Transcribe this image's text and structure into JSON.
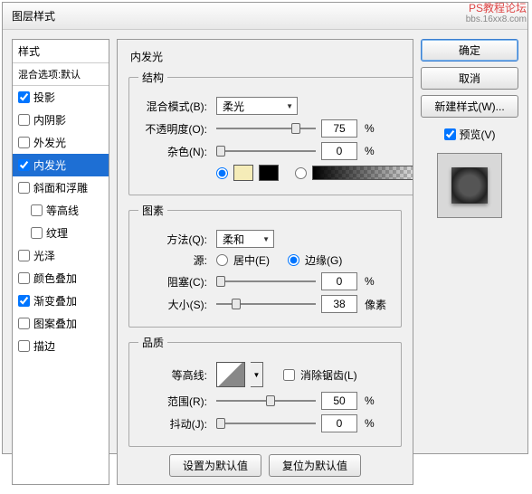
{
  "watermark": {
    "line1": "PS教程论坛",
    "line2": "bbs.16xx8.com"
  },
  "title": "图层样式",
  "styles_panel": {
    "header": "样式",
    "blend_defaults": "混合选项:默认",
    "items": [
      {
        "label": "投影",
        "checked": true,
        "indent": false
      },
      {
        "label": "内阴影",
        "checked": false,
        "indent": false
      },
      {
        "label": "外发光",
        "checked": false,
        "indent": false
      },
      {
        "label": "内发光",
        "checked": true,
        "indent": false,
        "selected": true
      },
      {
        "label": "斜面和浮雕",
        "checked": false,
        "indent": false
      },
      {
        "label": "等高线",
        "checked": false,
        "indent": true
      },
      {
        "label": "纹理",
        "checked": false,
        "indent": true
      },
      {
        "label": "光泽",
        "checked": false,
        "indent": false
      },
      {
        "label": "颜色叠加",
        "checked": false,
        "indent": false
      },
      {
        "label": "渐变叠加",
        "checked": true,
        "indent": false
      },
      {
        "label": "图案叠加",
        "checked": false,
        "indent": false
      },
      {
        "label": "描边",
        "checked": false,
        "indent": false
      }
    ]
  },
  "main": {
    "title": "内发光",
    "structure": {
      "legend": "结构",
      "blend_label": "混合模式(B):",
      "blend_value": "柔光",
      "opacity_label": "不透明度(O):",
      "opacity_value": "75",
      "opacity_unit": "%",
      "noise_label": "杂色(N):",
      "noise_value": "0",
      "noise_unit": "%"
    },
    "elements": {
      "legend": "图素",
      "technique_label": "方法(Q):",
      "technique_value": "柔和",
      "source_label": "源:",
      "source_center": "居中(E)",
      "source_edge": "边缘(G)",
      "choke_label": "阻塞(C):",
      "choke_value": "0",
      "choke_unit": "%",
      "size_label": "大小(S):",
      "size_value": "38",
      "size_unit": "像素"
    },
    "quality": {
      "legend": "品质",
      "contour_label": "等高线:",
      "antialias": "消除锯齿(L)",
      "range_label": "范围(R):",
      "range_value": "50",
      "range_unit": "%",
      "jitter_label": "抖动(J):",
      "jitter_value": "0",
      "jitter_unit": "%"
    },
    "buttons": {
      "set_default": "设置为默认值",
      "reset_default": "复位为默认值"
    }
  },
  "right": {
    "ok": "确定",
    "cancel": "取消",
    "new_style": "新建样式(W)...",
    "preview": "预览(V)"
  }
}
